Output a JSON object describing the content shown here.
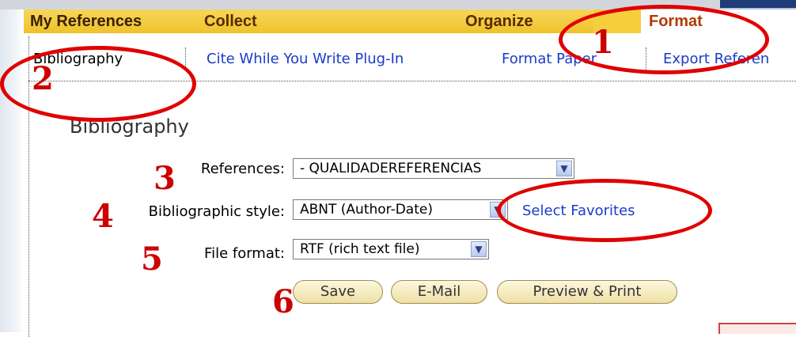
{
  "tabs": {
    "my_references": "My References",
    "collect": "Collect",
    "organize": "Organize",
    "format": "Format"
  },
  "subnav": {
    "bibliography": "Bibliography",
    "cite_while_you_write": "Cite While You Write Plug-In",
    "format_paper": "Format Paper",
    "export_references": "Export Referen"
  },
  "section_title": "Bibliography",
  "form": {
    "references_label": "References:",
    "references_value": "- QUALIDADEREFERENCIAS",
    "style_label": "Bibliographic style:",
    "style_value": "ABNT (Author-Date)",
    "select_favorites": "Select Favorites",
    "file_format_label": "File format:",
    "file_format_value": "RTF (rich text file)"
  },
  "buttons": {
    "save": "Save",
    "email": "E-Mail",
    "preview_print": "Preview & Print"
  },
  "annotations": {
    "m1": "1",
    "m2": "2",
    "m3": "3",
    "m4": "4",
    "m5": "5",
    "m6": "6"
  },
  "colors": {
    "tab_bar": "#f5ce3c",
    "link": "#1a3cc8",
    "annotation": "#e00000"
  },
  "icons": {
    "dropdown": "chevron-down-icon"
  }
}
